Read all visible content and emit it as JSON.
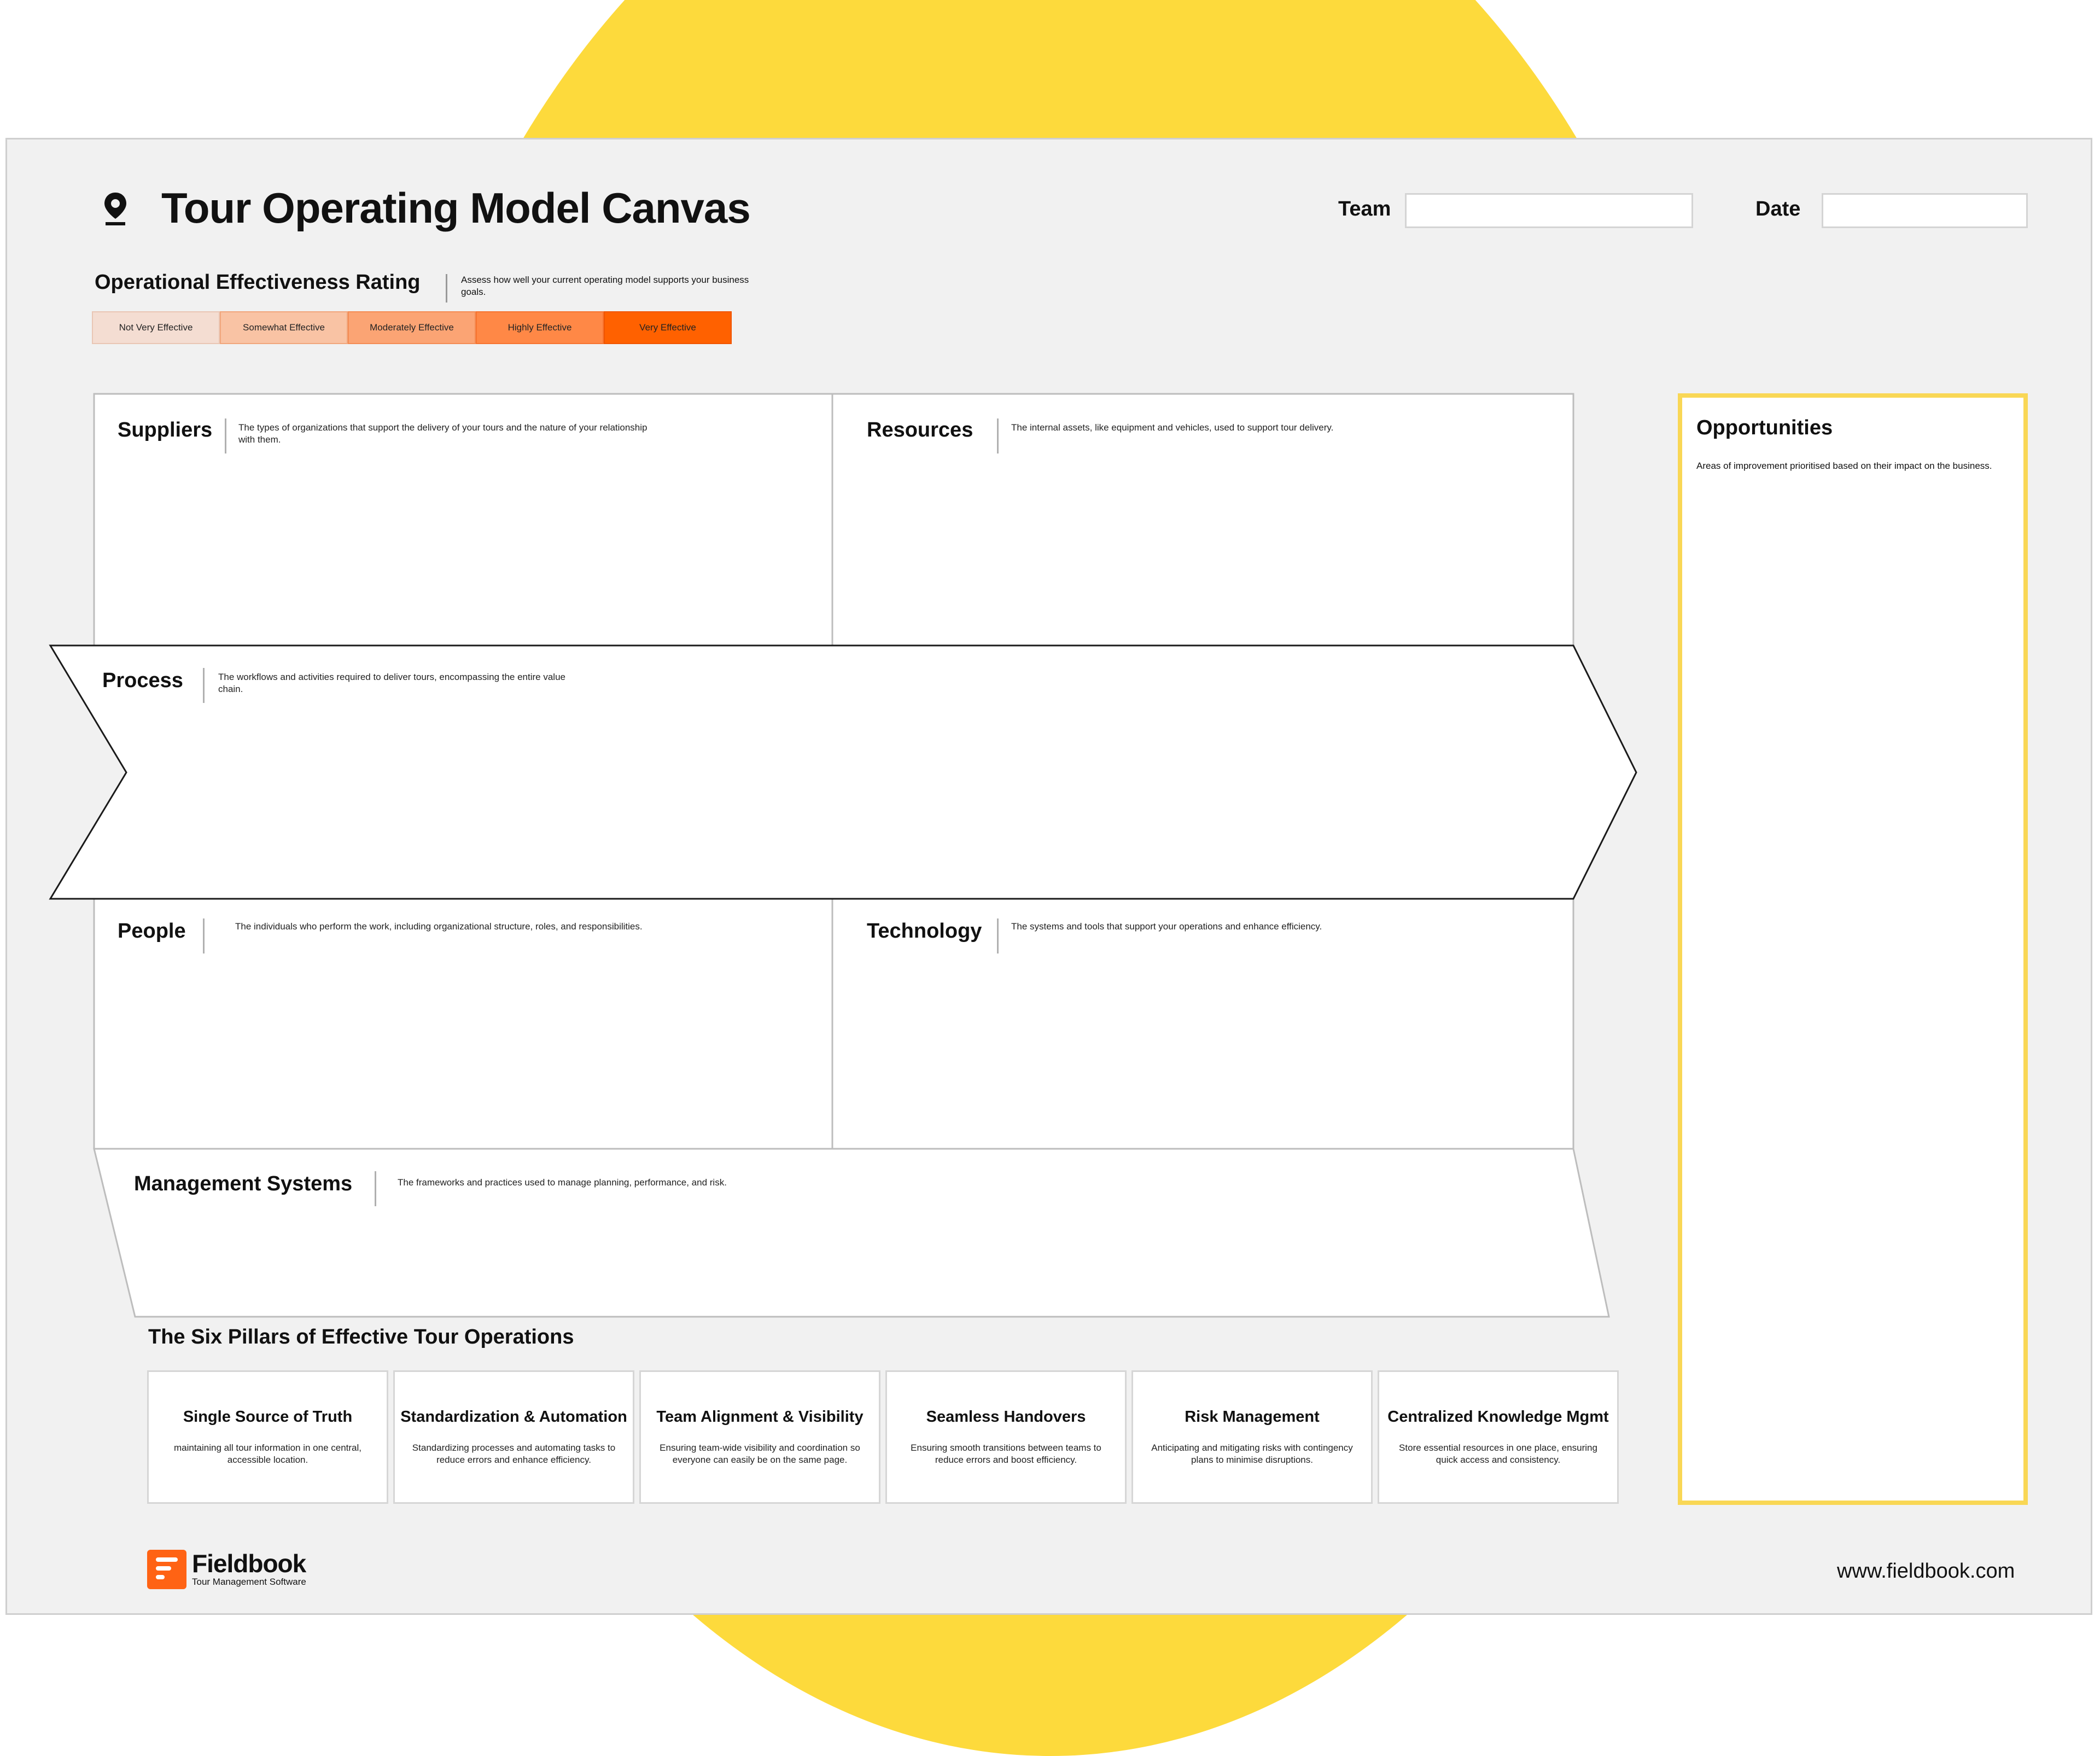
{
  "header": {
    "title": "Tour Operating Model Canvas",
    "team_label": "Team",
    "team_value": "",
    "date_label": "Date",
    "date_value": ""
  },
  "icons": {
    "title": "map-pin-icon",
    "logo": "fieldbook-logo-icon"
  },
  "rating": {
    "title": "Operational Effectiveness Rating",
    "description": "Assess how well your current operating model supports your business goals.",
    "levels": [
      {
        "label": "Not Very Effective",
        "color": "#F4DDD2"
      },
      {
        "label": "Somewhat Effective",
        "color": "#F9C3A4"
      },
      {
        "label": "Moderately Effective",
        "color": "#FBA474"
      },
      {
        "label": "Highly Effective",
        "color": "#FF8846"
      },
      {
        "label": "Very Effective",
        "color": "#FF6100"
      }
    ]
  },
  "boxes": {
    "suppliers": {
      "title": "Suppliers",
      "desc": "The types of organizations that support the delivery of your tours and the nature of your relationship with them."
    },
    "resources": {
      "title": "Resources",
      "desc": "The internal assets, like equipment and vehicles, used to support tour delivery."
    },
    "process": {
      "title": "Process",
      "desc": "The workflows and activities required to deliver tours, encompassing the entire value chain."
    },
    "people": {
      "title": "People",
      "desc": "The individuals who perform the work, including organizational structure, roles, and responsibilities."
    },
    "technology": {
      "title": "Technology",
      "desc": "The systems and tools that support your operations and enhance efficiency."
    },
    "management": {
      "title": "Management Systems",
      "desc": "The frameworks and practices used to manage planning, performance, and risk."
    },
    "opportunities": {
      "title": "Opportunities",
      "desc": "Areas of improvement prioritised based on their impact on the business."
    }
  },
  "pillars": {
    "title": "The Six Pillars of Effective Tour Operations",
    "items": [
      {
        "title": "Single Source of Truth",
        "desc": "maintaining all tour information in one central, accessible location."
      },
      {
        "title": "Standardization & Automation",
        "desc": "Standardizing processes and automating tasks to reduce errors and enhance efficiency."
      },
      {
        "title": "Team Alignment & Visibility",
        "desc": "Ensuring team-wide visibility and coordination so everyone can easily be on the same page."
      },
      {
        "title": "Seamless Handovers",
        "desc": "Ensuring smooth transitions between teams to reduce errors and boost efficiency."
      },
      {
        "title": "Risk Management",
        "desc": "Anticipating and mitigating risks with contingency plans to minimise disruptions."
      },
      {
        "title": "Centralized Knowledge Mgmt",
        "desc": "Store essential resources in one place, ensuring quick access and consistency."
      }
    ]
  },
  "footer": {
    "brand": "Fieldbook",
    "tagline": "Tour Management Software",
    "website": "www.fieldbook.com"
  },
  "colors": {
    "background_circle": "#FDDA3C",
    "sheet": "#F1F1F1",
    "accent": "#FF6314",
    "opportunities_border": "#F9D755"
  }
}
